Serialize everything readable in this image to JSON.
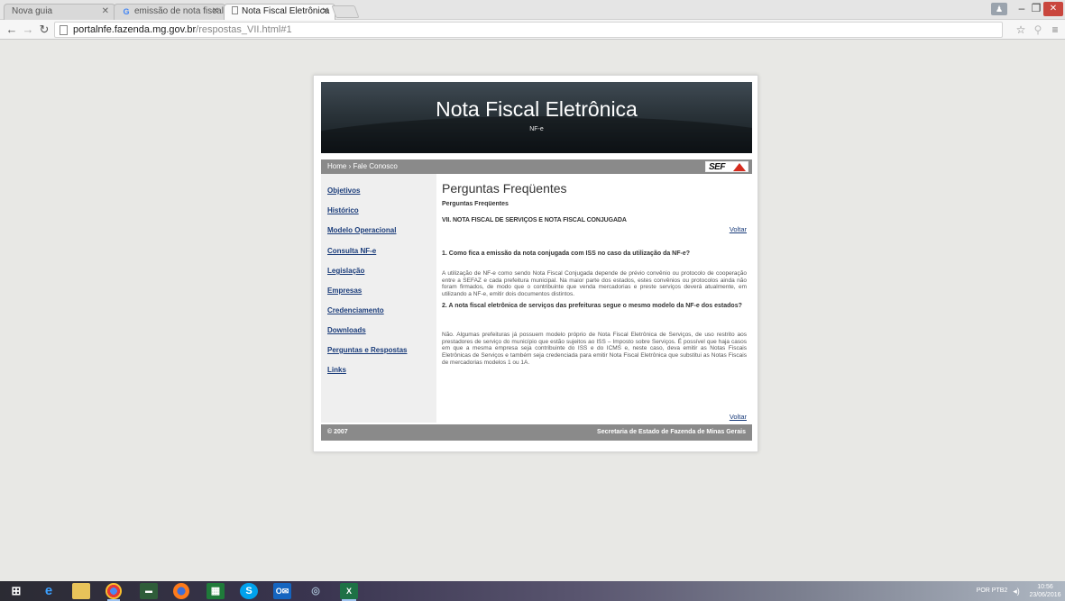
{
  "browser": {
    "tabs": [
      {
        "label": "Nova guia",
        "active": false,
        "icon": ""
      },
      {
        "label": "emissão de nota fiscal de",
        "active": false,
        "icon": "G"
      },
      {
        "label": "Nota Fiscal Eletrônica",
        "active": true,
        "icon": "page-icon"
      }
    ],
    "url_host": "portalnfe.fazenda.mg.gov.br",
    "url_path": "/respostas_VII.html#1"
  },
  "page": {
    "banner_title": "Nota Fiscal Eletrônica",
    "banner_sub": "NF-e",
    "breadcrumb": "Home › Fale Conosco",
    "logo_text": "SEF",
    "sidebar": [
      "Objetivos",
      "Histórico",
      "Modelo Operacional",
      "Consulta NF-e",
      "Legislação",
      "Empresas",
      "Credenciamento",
      "Downloads",
      "Perguntas e Respostas",
      "Links"
    ],
    "heading": "Perguntas Freqüentes",
    "subheading": "Perguntas Freqüentes",
    "section_title": "VII. NOTA FISCAL DE SERVIÇOS E NOTA FISCAL CONJUGADA",
    "back_label": "Voltar",
    "q1": "1. Como fica a emissão da nota conjugada com ISS no caso da utilização da NF-e?",
    "a1": "A utilização de NF-e como sendo Nota Fiscal Conjugada depende de prévio convênio ou protocolo de cooperação entre a SEFAZ e cada prefeitura municipal. Na maior parte dos estados, estes convênios ou protocolos ainda não foram firmados, de modo que o contribuinte que venda mercadorias e preste serviços deverá atualmente, em utilizando a NF-e, emitir dois documentos distintos.",
    "q2": "2. A nota fiscal eletrônica de serviços das prefeituras segue o mesmo modelo da NF-e dos estados?",
    "a2": "Não. Algumas prefeituras já possuem modelo próprio de Nota Fiscal Eletrônica de Serviços, de uso restrito aos prestadores de serviço do município que estão sujeitos ao ISS – Imposto sobre Serviços. É possível que haja casos em que a mesma empresa seja contribuinte do ISS e do ICMS e, neste caso, deva emitir as Notas Fiscais Eletrônicas de Serviços e também seja credenciada para emitir Nota Fiscal Eletrônica que substitui as Notas Fiscais de mercadorias modelos 1 ou 1A.",
    "footer_copy": "© 2007",
    "footer_org": "Secretaria de Estado de Fazenda de Minas Gerais"
  },
  "taskbar": {
    "time": "10:56",
    "date": "23/06/2016",
    "tray_text": "POR PTB2"
  },
  "colors": {
    "link": "#1a3c7a",
    "strip": "#8a8a8a",
    "sefa_red": "#d52b1e"
  }
}
